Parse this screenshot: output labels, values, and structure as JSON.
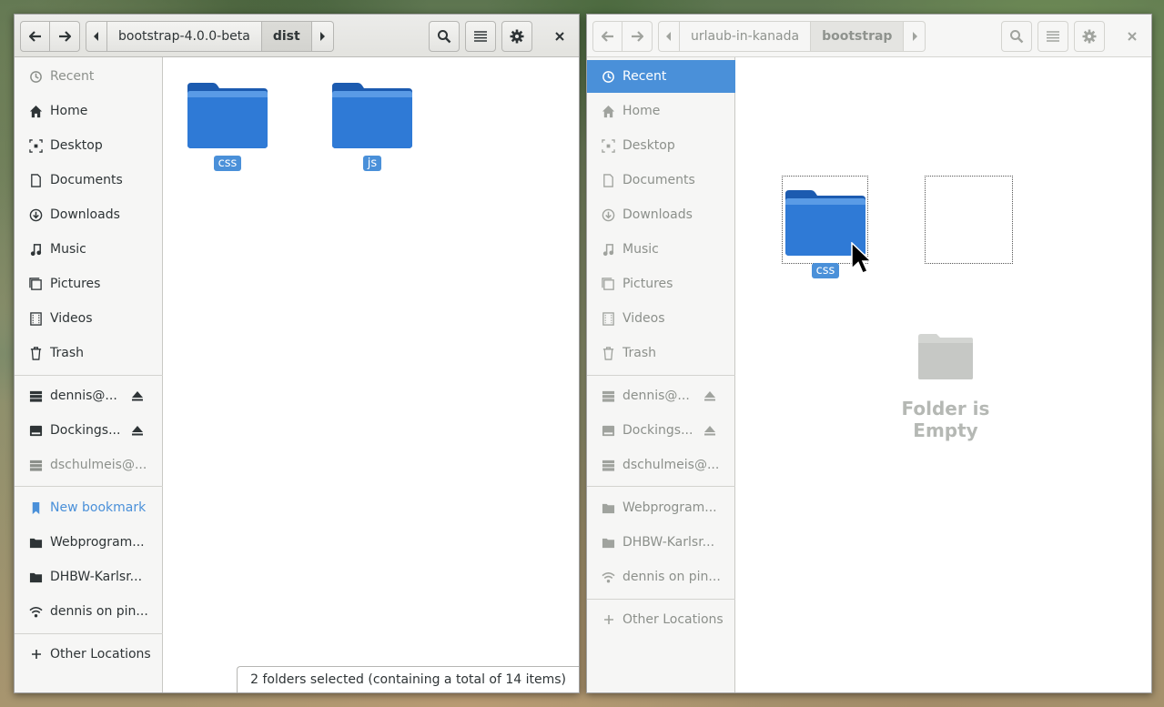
{
  "left_window": {
    "path": [
      "bootstrap-4.0.0-beta",
      "dist"
    ],
    "current_index": 1,
    "sidebar": {
      "items": [
        {
          "label": "Recent",
          "icon": "clock-icon"
        },
        {
          "label": "Home",
          "icon": "home-icon"
        },
        {
          "label": "Desktop",
          "icon": "desktop-icon"
        },
        {
          "label": "Documents",
          "icon": "document-icon"
        },
        {
          "label": "Downloads",
          "icon": "download-icon"
        },
        {
          "label": "Music",
          "icon": "music-icon"
        },
        {
          "label": "Pictures",
          "icon": "pictures-icon"
        },
        {
          "label": "Videos",
          "icon": "videos-icon"
        },
        {
          "label": "Trash",
          "icon": "trash-icon"
        }
      ],
      "devices": [
        {
          "label": "dennis@...",
          "icon": "server-icon",
          "eject": true
        },
        {
          "label": "Dockings...",
          "icon": "drive-icon",
          "eject": true
        },
        {
          "label": "dschulmeis@...",
          "icon": "server-icon",
          "eject": false
        }
      ],
      "bookmarks": [
        {
          "label": "New bookmark",
          "icon": "bookmark-icon"
        },
        {
          "label": "Webprogram...",
          "icon": "folder-icon"
        },
        {
          "label": "DHBW-Karlsr...",
          "icon": "folder-icon"
        },
        {
          "label": "dennis on pin...",
          "icon": "network-icon"
        }
      ],
      "other": {
        "label": "Other Locations",
        "icon": "plus-icon"
      }
    },
    "files": [
      {
        "name": "css",
        "selected": true
      },
      {
        "name": "js",
        "selected": true
      }
    ],
    "status": "2 folders selected  (containing a total of 14 items)"
  },
  "right_window": {
    "path": [
      "urlaub-in-kanada",
      "bootstrap"
    ],
    "current_index": 1,
    "sidebar": {
      "items": [
        {
          "label": "Recent",
          "icon": "clock-icon",
          "active": true
        },
        {
          "label": "Home",
          "icon": "home-icon"
        },
        {
          "label": "Desktop",
          "icon": "desktop-icon"
        },
        {
          "label": "Documents",
          "icon": "document-icon"
        },
        {
          "label": "Downloads",
          "icon": "download-icon"
        },
        {
          "label": "Music",
          "icon": "music-icon"
        },
        {
          "label": "Pictures",
          "icon": "pictures-icon"
        },
        {
          "label": "Videos",
          "icon": "videos-icon"
        },
        {
          "label": "Trash",
          "icon": "trash-icon"
        }
      ],
      "devices": [
        {
          "label": "dennis@...",
          "icon": "server-icon",
          "eject": true
        },
        {
          "label": "Dockings...",
          "icon": "drive-icon",
          "eject": true
        },
        {
          "label": "dschulmeis@...",
          "icon": "server-icon",
          "eject": false
        }
      ],
      "bookmarks": [
        {
          "label": "Webprogram...",
          "icon": "folder-icon"
        },
        {
          "label": "DHBW-Karlsr...",
          "icon": "folder-icon"
        },
        {
          "label": "dennis on pin...",
          "icon": "network-icon"
        }
      ],
      "other": {
        "label": "Other Locations",
        "icon": "plus-icon"
      }
    },
    "drag_preview": {
      "name": "css"
    },
    "empty_message": "Folder is Empty"
  },
  "colors": {
    "accent": "#4a90d9",
    "folder": "#2f7ad6",
    "sidebar_bg": "#f6f6f5"
  }
}
